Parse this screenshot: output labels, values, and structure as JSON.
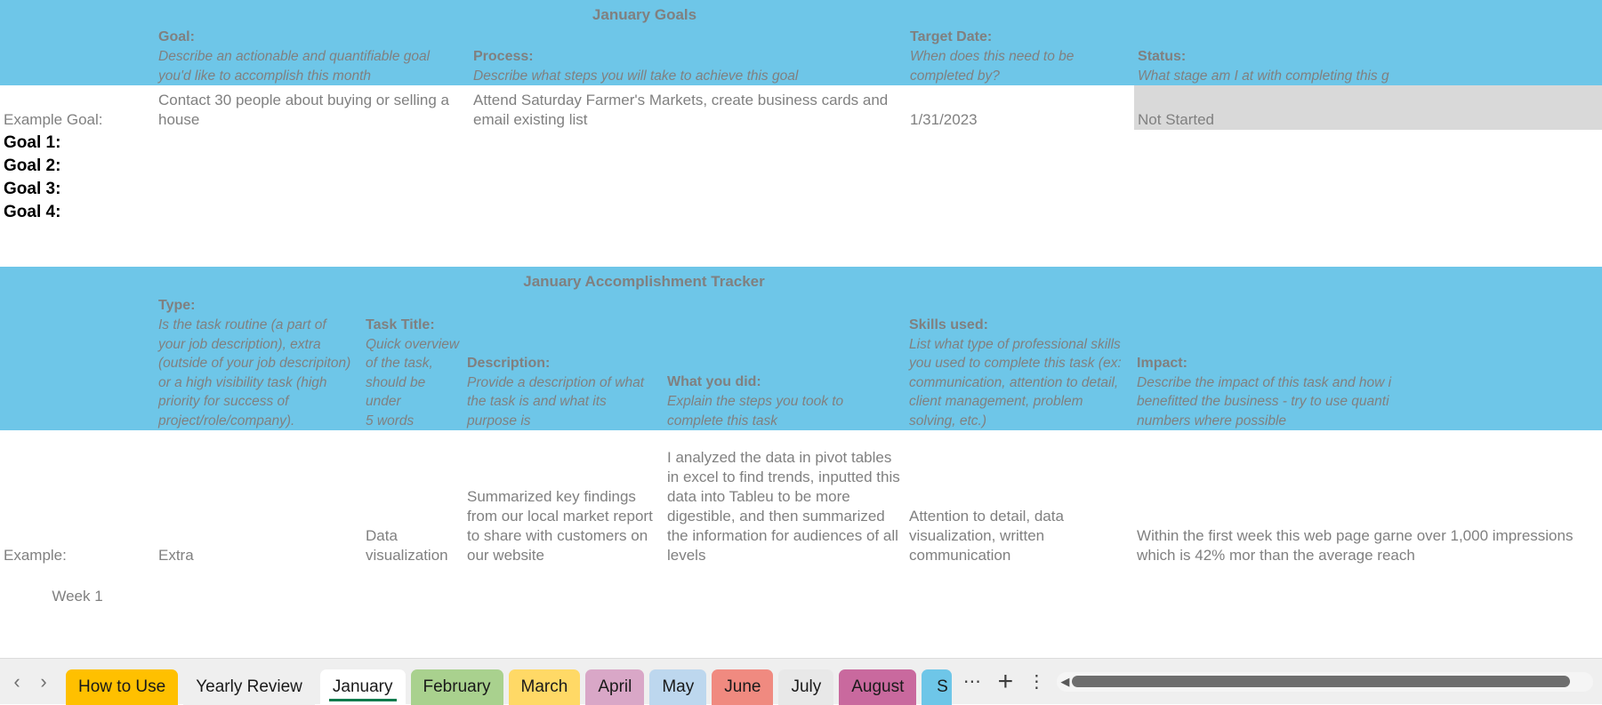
{
  "goals_section": {
    "title": "January Goals",
    "columns": [
      {
        "label": "",
        "sub": ""
      },
      {
        "label": "Goal:",
        "sub": "Describe an actionable and quantifiable goal you'd like to accomplish this month"
      },
      {
        "label": "Process:",
        "sub": "Describe what steps you will take to achieve this goal"
      },
      {
        "label": "Target Date:",
        "sub": "When does this need to be completed by?"
      },
      {
        "label": "Status:",
        "sub": "What stage am I at with completing this g"
      }
    ],
    "header_lines": {
      "goal_title": "Goal:",
      "goal_sub_1": "Describe an actionable and quantifiable goal",
      "goal_sub_2": "you'd like to accomplish this month",
      "process_title": "Process:",
      "process_sub_1": "Describe what steps you will take to achieve this goal",
      "target_title": "Target Date:",
      "target_sub_1": "When does this need to be",
      "target_sub_2": "completed by?",
      "status_title": "Status:",
      "status_sub_1": "What stage am I at with completing this g"
    },
    "rows": [
      {
        "label": "Example Goal:",
        "goal": "Contact 30 people about buying or selling a house",
        "process": "Attend Saturday Farmer's Markets, create business cards and email existing list",
        "target_date": "1/31/2023",
        "status": "Not Started"
      },
      {
        "label": "Goal 1:",
        "goal": "",
        "process": "",
        "target_date": "",
        "status": ""
      },
      {
        "label": "Goal 2:",
        "goal": "",
        "process": "",
        "target_date": "",
        "status": ""
      },
      {
        "label": "Goal 3:",
        "goal": "",
        "process": "",
        "target_date": "",
        "status": ""
      },
      {
        "label": "Goal 4:",
        "goal": "",
        "process": "",
        "target_date": "",
        "status": ""
      }
    ]
  },
  "tracker_section": {
    "title": "January Accomplishment Tracker",
    "header_lines": {
      "type_title": "Type:",
      "type_sub_1": "Is the task routine (a part of",
      "type_sub_2": "your job description), extra",
      "type_sub_3": "(outside of your job descripiton)",
      "type_sub_4": "or a high visibility task (high",
      "type_sub_5": "priority for success of",
      "type_sub_6": "project/role/company).",
      "task_title_title": "Task Title:",
      "task_title_sub_1": "Quick overview",
      "task_title_sub_2": "of the task,",
      "task_title_sub_3": "should be under",
      "task_title_sub_4": "5 words",
      "description_title": "Description:",
      "description_sub_1": "Provide a description of what",
      "description_sub_2": "the task is and what its",
      "description_sub_3": "purpose is",
      "whatyoudid_title": "What you did:",
      "whatyoudid_sub_1": "Explain the steps you took to",
      "whatyoudid_sub_2": "complete this task",
      "skills_title": "Skills used:",
      "skills_sub_1": "List what type of professional skills",
      "skills_sub_2": "you used to complete this task (ex:",
      "skills_sub_3": "communication, attention to detail,",
      "skills_sub_4": "client management, problem",
      "skills_sub_5": "solving, etc.)",
      "impact_title": "Impact:",
      "impact_sub_1": "Describe the impact of this task and how i",
      "impact_sub_2": "benefitted the business - try to use quanti",
      "impact_sub_3": "numbers where possible"
    },
    "example_row": {
      "label": "Example:",
      "type": "Extra",
      "task_title": "Data visualization",
      "description": "Summarized key findings from our local market report to share with customers on our website",
      "what_you_did": "I analyzed the data in pivot tables in excel to find trends, inputted this data into Tableu to be more digestible, and then summarized the information for audiences of all levels",
      "skills_used": "Attention to detail, data visualization, written communication",
      "impact": "Within the first week this web page garne over 1,000 impressions which is 42% mor than the average reach"
    },
    "week_label": "Week 1"
  },
  "tabbar": {
    "prev_icon": "chevron-left-icon",
    "next_icon": "chevron-right-icon",
    "tabs": [
      {
        "name": "How to Use",
        "color": "#FFC000",
        "active": false
      },
      {
        "name": "Yearly Review",
        "color": "#EFEFEF",
        "active": false
      },
      {
        "name": "January",
        "color": "#FFFFFF",
        "active": true
      },
      {
        "name": "February",
        "color": "#A9D18E",
        "active": false
      },
      {
        "name": "March",
        "color": "#FFD966",
        "active": false
      },
      {
        "name": "April",
        "color": "#D9A7C7",
        "active": false
      },
      {
        "name": "May",
        "color": "#BDD7EE",
        "active": false
      },
      {
        "name": "June",
        "color": "#F08A80",
        "active": false
      },
      {
        "name": "July",
        "color": "#E8E8E8",
        "active": false
      },
      {
        "name": "August",
        "color": "#C9699E",
        "active": false
      },
      {
        "name": "S",
        "color": "#6EC6E8",
        "active": false
      }
    ],
    "more_tabs_icon": "ellipsis-icon",
    "add_sheet_icon": "plus-icon",
    "all_sheets_icon": "vertical-ellipsis-icon",
    "scroll_left_icon": "scroll-left-arrow-icon"
  }
}
